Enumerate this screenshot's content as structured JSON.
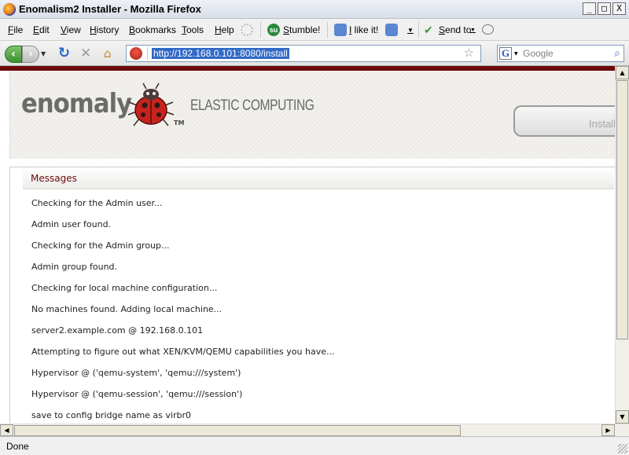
{
  "window": {
    "title": "Enomalism2 Installer - Mozilla Firefox",
    "min": "_",
    "max": "□",
    "close": "X"
  },
  "menu": {
    "items": [
      "File",
      "Edit",
      "View",
      "History",
      "Bookmarks",
      "Tools",
      "Help"
    ],
    "stumble": "Stumble!",
    "like": "I like it!",
    "send_to": "Send to"
  },
  "nav": {
    "url": "http://192.168.0.101:8080/install",
    "search_placeholder": "Google"
  },
  "page": {
    "logo": "enomaly",
    "tm": "TM",
    "tagline": "ELASTIC COMPUTING",
    "install_button": "Install",
    "messages_title": "Messages",
    "messages": [
      "Checking for the Admin user...",
      "Admin user found.",
      "Checking for the Admin group...",
      "Admin group found.",
      "Checking for local machine configuration...",
      "No machines found. Adding local machine...",
      "server2.example.com @ 192.168.0.101",
      "Attempting to figure out what XEN/KVM/QEMU capabilities you have...",
      "Hypervisor @ ('qemu-system', 'qemu:///system')",
      "Hypervisor @ ('qemu-session', 'qemu:///session')",
      "save to config bridge name as virbr0"
    ]
  },
  "status": {
    "text": "Done"
  }
}
